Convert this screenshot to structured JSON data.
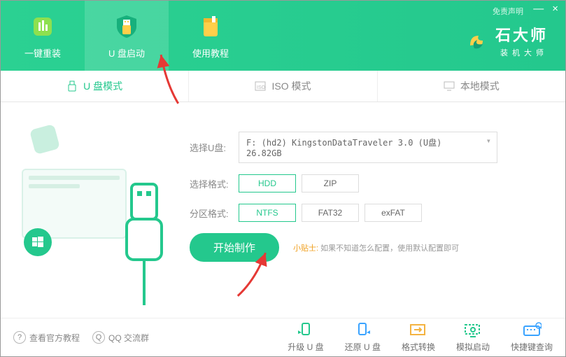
{
  "window": {
    "disclaimer": "免责声明",
    "minimize": "—",
    "close": "×"
  },
  "brand": {
    "title": "石大师",
    "subtitle": "装机大师"
  },
  "nav": [
    {
      "label": "一键重装",
      "icon": "bars-icon"
    },
    {
      "label": "U 盘启动",
      "icon": "shield-usb-icon"
    },
    {
      "label": "使用教程",
      "icon": "book-icon"
    }
  ],
  "mode_tabs": [
    {
      "label": "U 盘模式",
      "icon": "usb-icon",
      "active": true
    },
    {
      "label": "ISO 模式",
      "icon": "iso-icon",
      "active": false
    },
    {
      "label": "本地模式",
      "icon": "monitor-icon",
      "active": false
    }
  ],
  "form": {
    "usb_label": "选择U盘:",
    "usb_value": "F: (hd2) KingstonDataTraveler 3.0 (U盘) 26.82GB",
    "format_label": "选择格式:",
    "format_options": [
      "HDD",
      "ZIP"
    ],
    "format_selected": "HDD",
    "partition_label": "分区格式:",
    "partition_options": [
      "NTFS",
      "FAT32",
      "exFAT"
    ],
    "partition_selected": "NTFS",
    "start_button": "开始制作",
    "tip_prefix": "小贴士:",
    "tip_text": "如果不知道怎么配置，使用默认配置即可"
  },
  "bottom_left": [
    {
      "label": "查看官方教程",
      "icon": "help-icon"
    },
    {
      "label": "QQ 交流群",
      "icon": "qq-icon"
    }
  ],
  "bottom_actions": [
    {
      "label": "升级 U 盘",
      "icon": "upgrade-usb-icon",
      "color": "#24c88d"
    },
    {
      "label": "还原 U 盘",
      "icon": "restore-usb-icon",
      "color": "#3aa3ff"
    },
    {
      "label": "格式转换",
      "icon": "format-convert-icon",
      "color": "#f4b341"
    },
    {
      "label": "模拟启动",
      "icon": "simulate-boot-icon",
      "color": "#24c88d"
    },
    {
      "label": "快捷键查询",
      "icon": "shortcut-key-icon",
      "color": "#3aa3ff"
    }
  ]
}
